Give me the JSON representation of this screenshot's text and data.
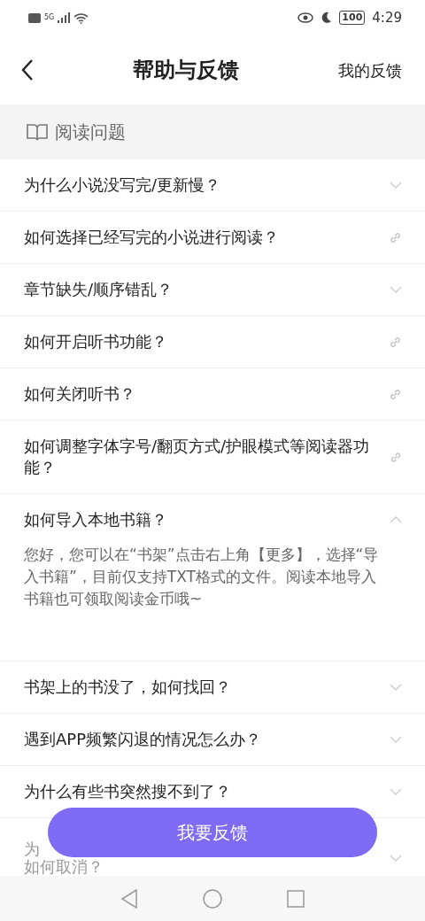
{
  "status_bar": {
    "time": "4:29",
    "battery": "100",
    "network": "5G"
  },
  "header": {
    "title": "帮助与反馈",
    "action": "我的反馈"
  },
  "section": {
    "title": "阅读问题"
  },
  "questions": [
    {
      "kind": "expand",
      "title": "为什么小说没写完/更新慢？",
      "expanded": false
    },
    {
      "kind": "link",
      "title": "如何选择已经写完的小说进行阅读？"
    },
    {
      "kind": "expand",
      "title": "章节缺失/顺序错乱？",
      "expanded": false
    },
    {
      "kind": "link",
      "title": "如何开启听书功能？"
    },
    {
      "kind": "link",
      "title": "如何关闭听书？"
    },
    {
      "kind": "link",
      "title": "如何调整字体字号/翻页方式/护眼模式等阅读器功能？"
    },
    {
      "kind": "expand",
      "title": "如何导入本地书籍？",
      "expanded": true,
      "answer": "您好，您可以在“书架”点击右上角【更多】，选择“导入书籍”，目前仅支持TXT格式的文件。阅读本地导入书籍也可领取阅读金币哦~"
    },
    {
      "kind": "expand",
      "title": "书架上的书没了，如何找回？",
      "expanded": false
    },
    {
      "kind": "expand",
      "title": "遇到APP频繁闪退的情况怎么办？",
      "expanded": false
    },
    {
      "kind": "expand",
      "title": "为什么有些书突然搜不到了？",
      "expanded": false
    },
    {
      "kind": "partial",
      "title_start": "为",
      "title_end": "如何取消？",
      "expanded": false
    }
  ],
  "feedback_button": "我要反馈"
}
